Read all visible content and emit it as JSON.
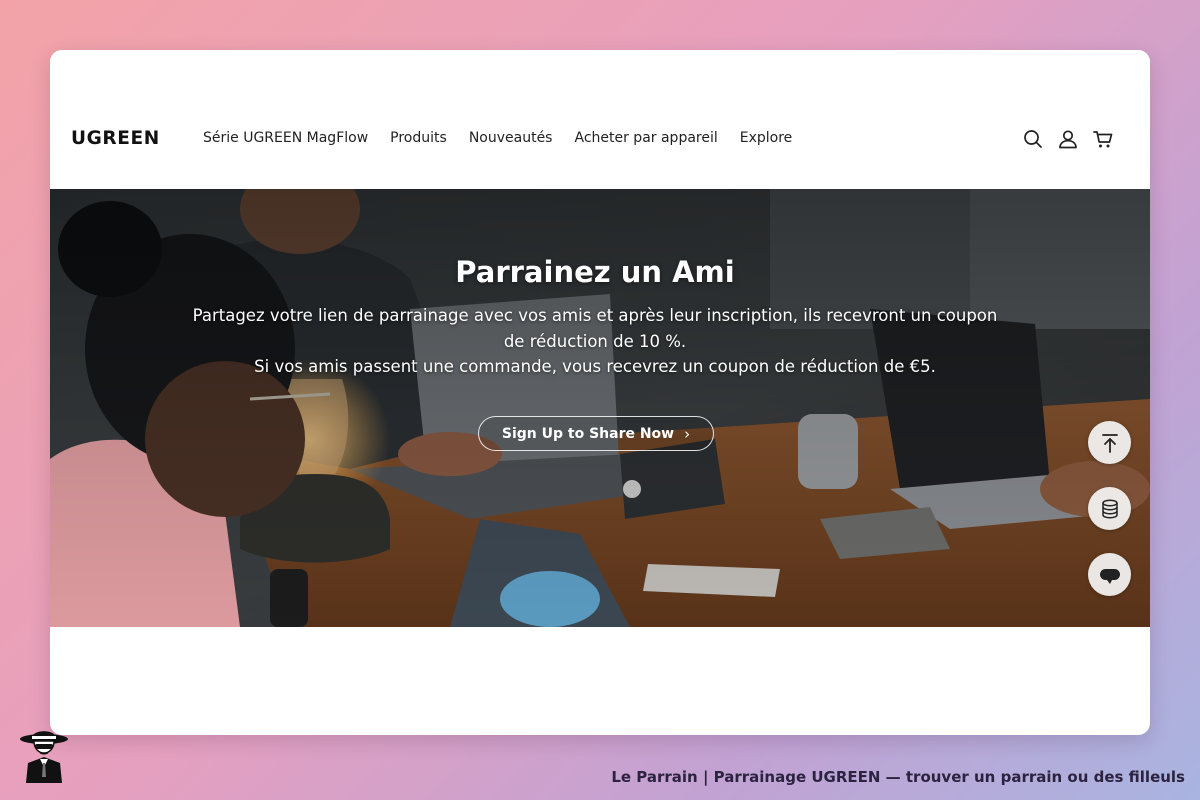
{
  "header": {
    "logo": "UGREEN",
    "nav": [
      "Série UGREEN MagFlow",
      "Produits",
      "Nouveautés",
      "Acheter par appareil",
      "Explore"
    ],
    "icons": [
      "search-icon",
      "account-icon",
      "cart-icon"
    ]
  },
  "hero": {
    "title": "Parrainez un Ami",
    "description_line1": "Partagez votre lien de parrainage avec vos amis et après leur inscription, ils recevront un coupon de réduction de 10 %.",
    "description_line2": "Si vos amis passent une commande, vous recevrez un coupon de réduction de €5.",
    "cta_label": "Sign Up to Share Now",
    "cta_chevron": "›"
  },
  "floating_actions": [
    "back-to-top-icon",
    "coins-stack-icon",
    "chat-bubble-icon"
  ],
  "footer": {
    "caption": "Le Parrain | Parrainage UGREEN — trouver un parrain ou des filleuls"
  },
  "colors": {
    "background_start": "#f3a3a8",
    "background_end": "#a9b4e0",
    "text_dark": "#222222",
    "hero_text": "#ffffff"
  }
}
